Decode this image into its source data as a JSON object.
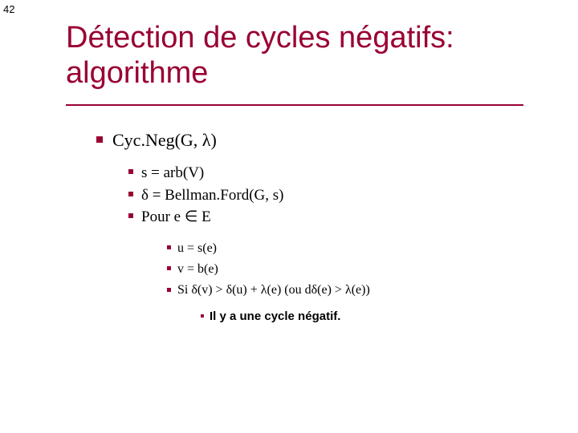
{
  "pageNumber": "42",
  "title_line1": "Détection de cycles négatifs:",
  "title_line2": "algorithme",
  "l1": "Cyc.Neg(G, λ)",
  "l2a": "s = arb(V)",
  "l2b": "δ = Bellman.Ford(G, s)",
  "l2c": "Pour e ∈ E",
  "l3a": "u = s(e)",
  "l3b": "v = b(e)",
  "l3c": "Si δ(v) > δ(u) + λ(e)  (ou dδ(e) > λ(e))",
  "l4": "Il y a une cycle négatif."
}
